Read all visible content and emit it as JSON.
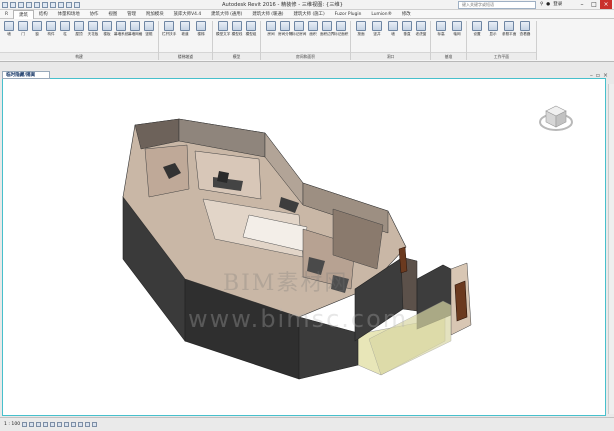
{
  "titlebar": {
    "title": "Autodesk Revit 2016 -    精装修 - 三维视图: {三维}",
    "search_placeholder": "键入关键字或短语",
    "signin": "登录"
  },
  "tabs": [
    "建筑",
    "结构",
    "体量和场地",
    "协作",
    "视图",
    "管理",
    "附加模块",
    "族库大师V4.4",
    "建筑大师 (通用)",
    "建筑大师 (暖通)",
    "建筑大师 (施工)",
    "Fuzor Plugin",
    "Lumion®",
    "修改"
  ],
  "ribbon": {
    "tools": [
      "墙",
      "门",
      "窗",
      "构件",
      "柱",
      "屋顶",
      "天花板",
      "楼板",
      "幕墙系统",
      "幕墙网格",
      "竖梃",
      "栏杆扶手",
      "坡道",
      "楼梯",
      "模型文字",
      "模型线",
      "模型组",
      "房间",
      "房间分隔",
      "标记房间",
      "面积",
      "面积边界",
      "标记面积",
      "按面",
      "竖井",
      "墙",
      "垂直",
      "老虎窗",
      "标高",
      "轴网",
      "设置",
      "显示",
      "参照平面",
      "查看器"
    ],
    "groups": [
      "构建",
      "楼梯坡道",
      "模型",
      "房间和面积",
      "洞口",
      "基准",
      "工作平面"
    ]
  },
  "view": {
    "tab_label": "临时隐藏/隔离",
    "watermark_cn": "BIM素材网",
    "watermark_url": "www.bimsc.com"
  },
  "status": {
    "scale": "1 : 100"
  }
}
